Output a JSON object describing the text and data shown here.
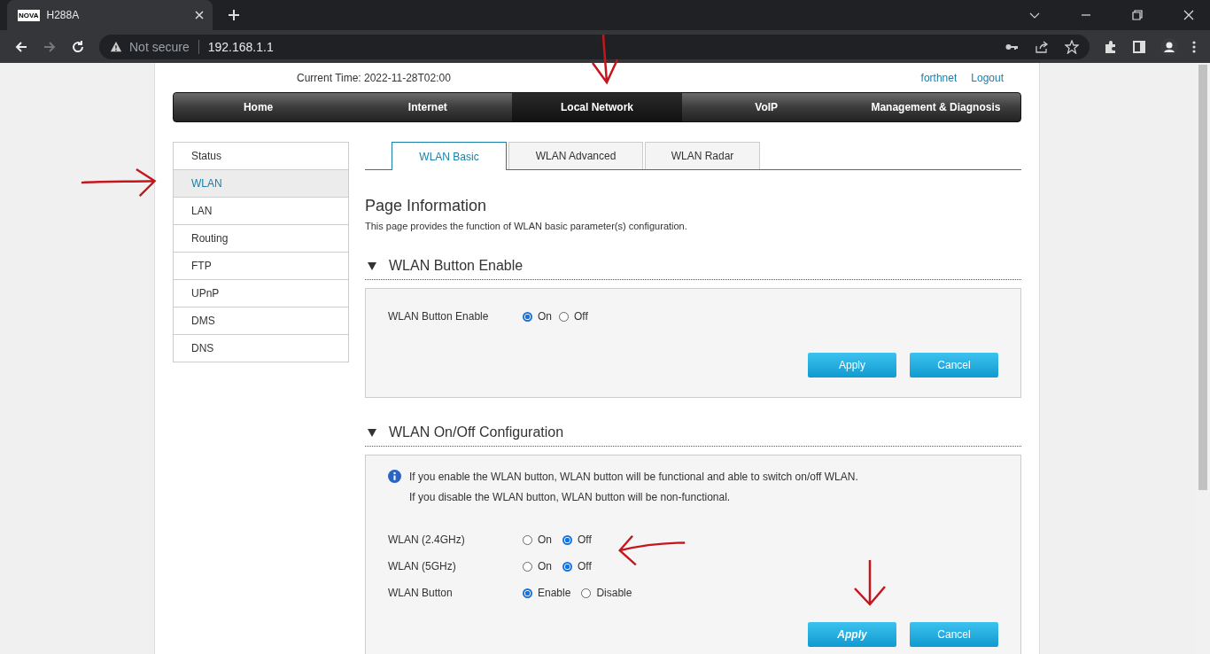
{
  "browser": {
    "tab_title": "H288A",
    "favicon_text": "NOVA",
    "security": "Not secure",
    "url": "192.168.1.1"
  },
  "header": {
    "current_time": "Current Time: 2022-11-28T02:00",
    "user": "forthnet",
    "logout": "Logout"
  },
  "nav": [
    {
      "label": "Home",
      "selected": false
    },
    {
      "label": "Internet",
      "selected": false
    },
    {
      "label": "Local Network",
      "selected": true
    },
    {
      "label": "VoIP",
      "selected": false
    },
    {
      "label": "Management & Diagnosis",
      "selected": false
    }
  ],
  "sidebar": {
    "items": [
      {
        "label": "Status",
        "selected": false
      },
      {
        "label": "WLAN",
        "selected": true
      },
      {
        "label": "LAN",
        "selected": false
      },
      {
        "label": "Routing",
        "selected": false
      },
      {
        "label": "FTP",
        "selected": false
      },
      {
        "label": "UPnP",
        "selected": false
      },
      {
        "label": "DMS",
        "selected": false
      },
      {
        "label": "DNS",
        "selected": false
      }
    ]
  },
  "tabs": [
    {
      "label": "WLAN Basic",
      "selected": true
    },
    {
      "label": "WLAN Advanced",
      "selected": false
    },
    {
      "label": "WLAN Radar",
      "selected": false
    }
  ],
  "page_title": "Page Information",
  "page_description": "This page provides the function of WLAN basic parameter(s) configuration.",
  "sections": [
    {
      "title": "WLAN Button Enable",
      "expanded": true,
      "fields": [
        {
          "label": "WLAN Button Enable",
          "options": [
            {
              "label": "On",
              "selected": true
            },
            {
              "label": "Off",
              "selected": false
            }
          ]
        }
      ],
      "buttons": [
        {
          "label": "Apply",
          "focused": false
        },
        {
          "label": "Cancel",
          "focused": false
        }
      ]
    },
    {
      "title": "WLAN On/Off Configuration",
      "expanded": true,
      "info": [
        "If you enable the WLAN button, WLAN button will be functional and able to switch on/off WLAN.",
        "If you disable the WLAN button, WLAN button will be non-functional."
      ],
      "fields": [
        {
          "label": "WLAN (2.4GHz)",
          "options": [
            {
              "label": "On",
              "selected": false
            },
            {
              "label": "Off",
              "selected": true
            }
          ]
        },
        {
          "label": "WLAN (5GHz)",
          "options": [
            {
              "label": "On",
              "selected": false
            },
            {
              "label": "Off",
              "selected": true
            }
          ]
        },
        {
          "label": "WLAN Button",
          "options": [
            {
              "label": "Enable",
              "selected": true
            },
            {
              "label": "Disable",
              "selected": false
            }
          ]
        }
      ],
      "buttons": [
        {
          "label": "Apply",
          "focused": true
        },
        {
          "label": "Cancel",
          "focused": false
        }
      ]
    }
  ]
}
